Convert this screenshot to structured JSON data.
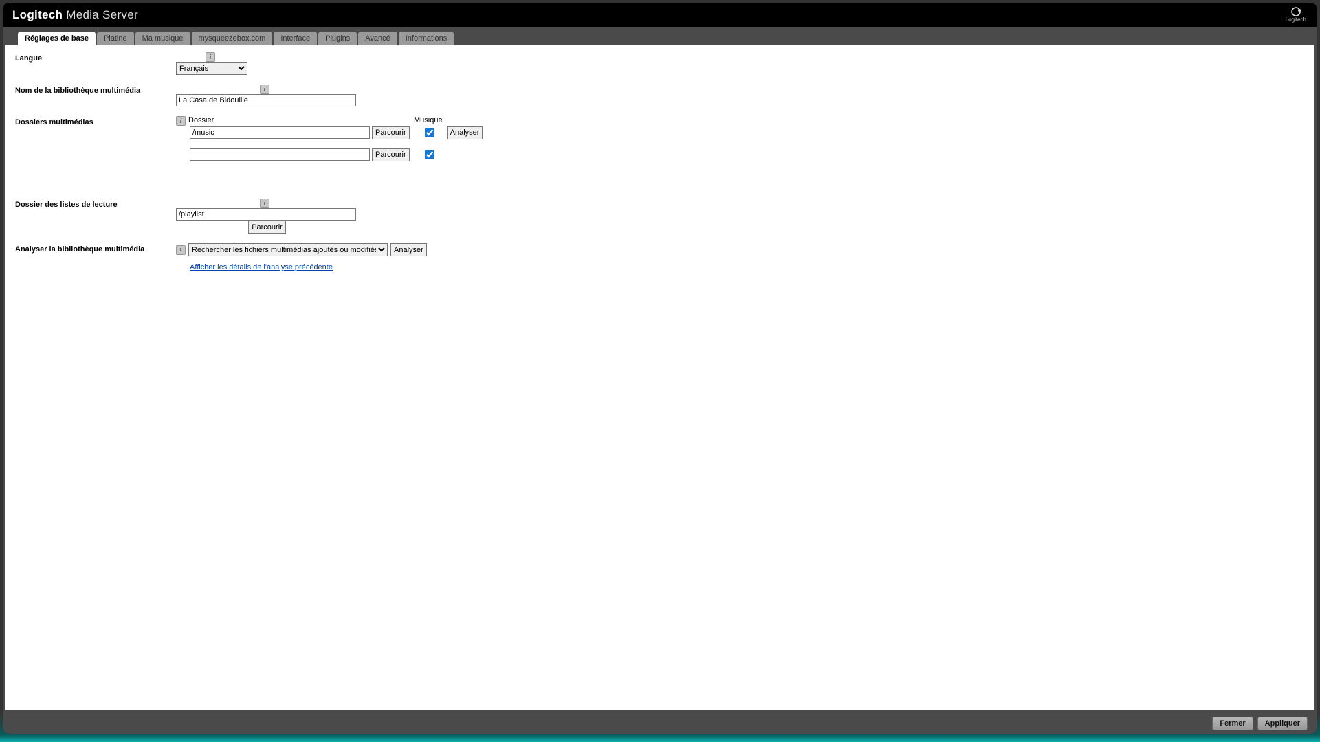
{
  "header": {
    "title_bold": "Logitech",
    "title_rest": " Media Server",
    "logo_label": "Logitech"
  },
  "tabs": [
    {
      "label": "Réglages de base",
      "active": true
    },
    {
      "label": "Platine",
      "active": false
    },
    {
      "label": "Ma musique",
      "active": false
    },
    {
      "label": "mysqueezebox.com",
      "active": false
    },
    {
      "label": "Interface",
      "active": false
    },
    {
      "label": "Plugins",
      "active": false
    },
    {
      "label": "Avancé",
      "active": false
    },
    {
      "label": "Informations",
      "active": false
    }
  ],
  "labels": {
    "language": "Langue",
    "library_name": "Nom de la bibliothèque multimédia",
    "media_folders": "Dossiers multimédias",
    "playlist_folder": "Dossier des listes de lecture",
    "rescan": "Analyser la bibliothèque multimédia",
    "folder_col": "Dossier",
    "music_col": "Musique"
  },
  "values": {
    "language_selected": "Français",
    "library_name": "La Casa de Bidouille",
    "folder1_path": "/music",
    "folder1_music_checked": true,
    "folder2_path": "",
    "folder2_music_checked": true,
    "playlist_path": "/playlist",
    "rescan_mode": "Rechercher les fichiers multimédias ajoutés ou modifiés"
  },
  "buttons": {
    "browse": "Parcourir",
    "analyze": "Analyser",
    "close": "Fermer",
    "apply": "Appliquer"
  },
  "links": {
    "show_last_scan": "Afficher les détails de l'analyse précédente"
  },
  "info_icon_text": "i"
}
